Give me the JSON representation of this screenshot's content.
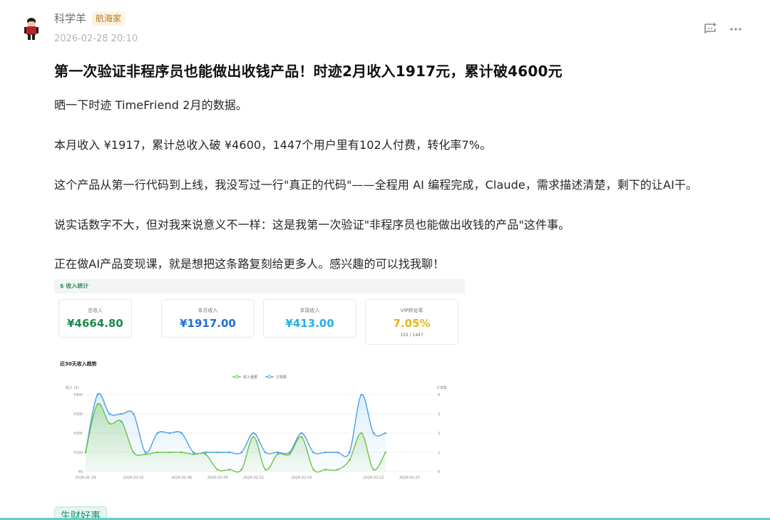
{
  "author": {
    "name": "科学羊",
    "badge": "航海家",
    "time": "2026-02-28 20:10"
  },
  "icons": {
    "avatar": "cartoon-person-avatar",
    "comment": "comment-add-icon",
    "more": "more-horizontal-icon"
  },
  "post": {
    "title": "第一次验证非程序员也能做出收钱产品！时迹2月收入1917元，累计破4600元",
    "paragraphs": [
      "晒一下时迹 TimeFriend 2月的数据。",
      "本月收入 ¥1917，累计总收入破 ¥4600，1447个用户里有102人付费，转化率7%。",
      "这个产品从第一行代码到上线，我没写过一行\"真正的代码\"——全程用 AI 编程完成，Claude，需求描述清楚，剩下的让AI干。",
      "说实话数字不大，但对我来说意义不一样：这是我第一次验证\"非程序员也能做出收钱的产品\"这件事。",
      "正在做AI产品变现课，就是想把这条路复刻给更多人。感兴趣的可以找我聊！"
    ]
  },
  "stats": {
    "header": "$ 收入统计",
    "cards": [
      {
        "label": "总收入",
        "value": "¥4664.80",
        "color": "#1e8a4c"
      },
      {
        "label": "本月收入",
        "value": "¥1917.00",
        "color": "#1f6fd6"
      },
      {
        "label": "本周收入",
        "value": "¥413.00",
        "color": "#27b0e0"
      },
      {
        "label": "VIP转化率",
        "value": "7.05%",
        "sub": "102 / 1447",
        "color": "#e6b51e"
      }
    ],
    "trend_title": "近30天收入趋势"
  },
  "chart_data": {
    "type": "line",
    "x": [
      "2026-01-29",
      "2026-01-30",
      "2026-01-31",
      "2026-02-01",
      "2026-02-02",
      "2026-02-03",
      "2026-02-04",
      "2026-02-05",
      "2026-02-06",
      "2026-02-07",
      "2026-02-08",
      "2026-02-09",
      "2026-02-10",
      "2026-02-11",
      "2026-02-12",
      "2026-02-13",
      "2026-02-14",
      "2026-02-15",
      "2026-02-16",
      "2026-02-17",
      "2026-02-18",
      "2026-02-19",
      "2026-02-20",
      "2026-02-21",
      "2026-02-22",
      "2026-02-23",
      "2026-02-24",
      "2026-02-25",
      "2026-02-26",
      "2026-02-27"
    ],
    "xticks": [
      "2026-01-29",
      "2026-02-02",
      "2026-02-06",
      "2026-02-09",
      "2026-02-12",
      "2026-02-16",
      "2026-02-22",
      "2026-02-25"
    ],
    "series": [
      {
        "name": "收入金额",
        "axis": "left",
        "color": "#6cc24a",
        "values": [
          100,
          350,
          250,
          260,
          100,
          90,
          100,
          100,
          100,
          90,
          90,
          10,
          10,
          10,
          180,
          10,
          90,
          90,
          180,
          10,
          10,
          10,
          60,
          200,
          10,
          100,
          null,
          null,
          null,
          null
        ]
      },
      {
        "name": "订单数",
        "axis": "right",
        "color": "#4b9fe6",
        "values": [
          1,
          4,
          3,
          3,
          3,
          1,
          2,
          2,
          2,
          1,
          1,
          1,
          1,
          1,
          2,
          1,
          1,
          1,
          2,
          1,
          1,
          1,
          1,
          4,
          2,
          2,
          null,
          null,
          null,
          null
        ]
      }
    ],
    "ylabel_left": "收入 (¥)",
    "ylabel_right": "订单数",
    "yticks_left": [
      "¥0",
      "¥100",
      "¥200",
      "¥300",
      "¥400"
    ],
    "yticks_right": [
      "0",
      "1",
      "2",
      "3",
      "4"
    ],
    "ylim_left": [
      0,
      400
    ],
    "ylim_right": [
      0,
      4
    ],
    "legend_position": "top-center",
    "grid": true
  },
  "tags": {
    "topic": "生财好事"
  }
}
